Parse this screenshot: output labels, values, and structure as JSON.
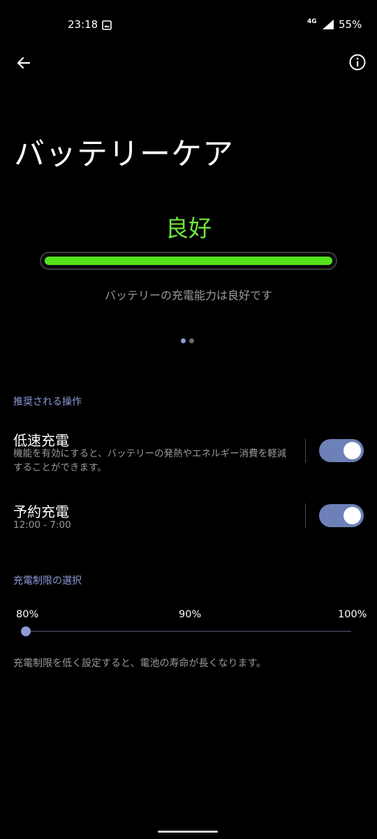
{
  "status_bar": {
    "time": "23:18",
    "network": "4G",
    "battery": "55%"
  },
  "page": {
    "title": "バッテリーケア"
  },
  "health": {
    "status": "良好",
    "level": 1.0,
    "description": "バッテリーの充電能力は良好です",
    "status_color": "#6ee33b"
  },
  "pager": {
    "pages": 2,
    "current": 1
  },
  "recommended": {
    "header": "推奨される操作",
    "items": [
      {
        "title": "低速充電",
        "subtitle": "機能を有効にすると、バッテリーの発熱やエネルギー消費を軽減することができます。",
        "enabled": true
      },
      {
        "title": "予約充電",
        "subtitle": "12:00 - 7:00",
        "enabled": true
      }
    ]
  },
  "charge_limit": {
    "header": "充電制限の選択",
    "options": [
      "80%",
      "90%",
      "100%"
    ],
    "selected": "80%",
    "note": "充電制限を低く設定すると、電池の寿命が長くなります。"
  },
  "colors": {
    "accent": "#8d9bd8",
    "toggle_on": "#6d80b8",
    "good": "#55e31c"
  }
}
